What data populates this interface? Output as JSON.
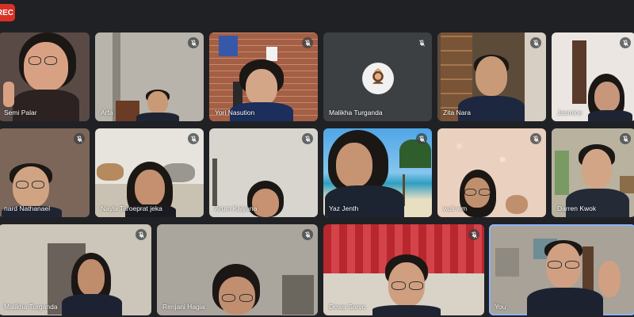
{
  "recording": {
    "label": "REC"
  },
  "participants": [
    {
      "name": "Semi Palar",
      "muted": false
    },
    {
      "name": "Arfa",
      "muted": true
    },
    {
      "name": "Yori Nasution",
      "muted": true
    },
    {
      "name": "Malikha Turganda",
      "muted": true
    },
    {
      "name": "Zita Nara",
      "muted": true
    },
    {
      "name": "Jasmine",
      "muted": true
    },
    {
      "name": "nard Nathanael",
      "muted": true
    },
    {
      "name": "Nayla Taroeprat jeka",
      "muted": true
    },
    {
      "name": "Arum Kaiyana",
      "muted": true
    },
    {
      "name": "Yaz Jenth",
      "muted": true
    },
    {
      "name": "wuli wm",
      "muted": true
    },
    {
      "name": "Darren Kwok",
      "muted": true
    },
    {
      "name": "Malikha Turganda",
      "muted": true
    },
    {
      "name": "Renjani Hagia",
      "muted": true
    },
    {
      "name": "Dewa Sarvo",
      "muted": true
    },
    {
      "name": "You",
      "muted": false
    }
  ]
}
